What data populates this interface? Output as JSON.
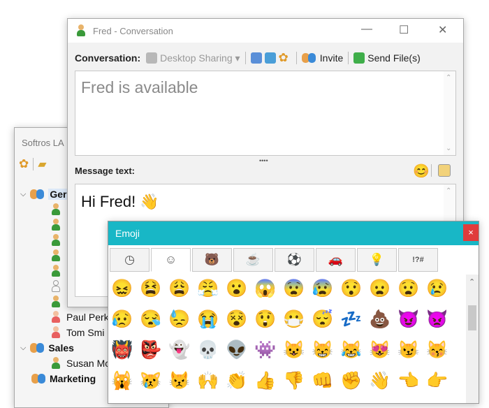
{
  "main_window": {
    "title": "Softros LA",
    "tree": {
      "groups": [
        {
          "name": "Ger",
          "members": []
        },
        {
          "name": "Sales"
        },
        {
          "name": "Marketing"
        }
      ],
      "people": [
        "Paul Perk",
        "Tom Smi",
        "Susan Mc"
      ]
    }
  },
  "conversation": {
    "title": "Fred - Conversation",
    "label": "Conversation:",
    "desktop_sharing": "Desktop Sharing ▾",
    "invite": "Invite",
    "send_files": "Send File(s)",
    "status_text": "Fred is available",
    "message_label": "Message text:",
    "message_value": "Hi Fred! 👋",
    "splitter": "••••"
  },
  "emoji_picker": {
    "title": "Emoji",
    "close": "×",
    "tabs": [
      "◷",
      "☺",
      "🐻",
      "☕",
      "⚽",
      "🚗",
      "💡",
      "!?#"
    ],
    "rows": [
      [
        "😖",
        "😫",
        "😩",
        "😤",
        "😮",
        "😱",
        "😨",
        "😰",
        "😯",
        "😦",
        "😧",
        "😢"
      ],
      [
        "😥",
        "😪",
        "😓",
        "😭",
        "😵",
        "😲",
        "😷",
        "😴",
        "💤",
        "💩",
        "😈",
        "👿"
      ],
      [
        "👹",
        "👺",
        "👻",
        "💀",
        "👽",
        "👾",
        "😺",
        "😸",
        "😹",
        "😻",
        "😼",
        "😽"
      ],
      [
        "🙀",
        "😿",
        "😾",
        "🙌",
        "👏",
        "👍",
        "👎",
        "👊",
        "✊",
        "👋",
        "👈",
        "👉"
      ]
    ]
  },
  "icons": {
    "puzzle": "puzzle-icon",
    "folder": "folder-icon",
    "person": "person-icon"
  }
}
